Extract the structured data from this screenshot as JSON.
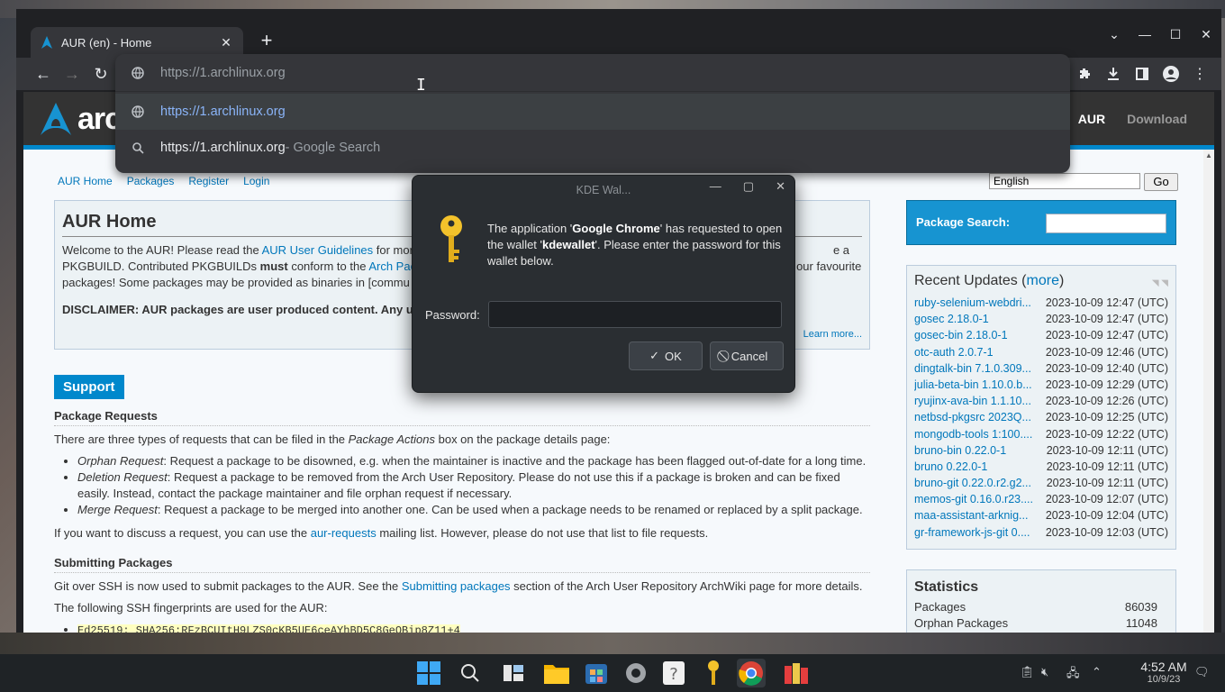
{
  "browser": {
    "tab_title": "AUR (en) - Home",
    "address_typed": "https://1.archlinux.org",
    "suggestions": [
      {
        "text": "https://1.archlinux.org",
        "suffix": ""
      },
      {
        "text": "https://1.archlinux.org",
        "suffix": " - Google Search"
      }
    ]
  },
  "site": {
    "logo_text": "arch",
    "nav": [
      "AUR",
      "Download"
    ],
    "subnav": [
      "AUR Home",
      "Packages",
      "Register",
      "Login"
    ],
    "language": "English",
    "go_label": "Go",
    "home_title": "AUR Home",
    "welcome_1a": "Welcome to the AUR! Please read the ",
    "welcome_link1": "AUR User Guidelines",
    "welcome_1b": " for mor",
    "welcome_1c": "e a",
    "welcome_2a": "PKGBUILD. Contributed PKGBUILDs ",
    "welcome_must": "must",
    "welcome_2b": " conform to the ",
    "welcome_link2": "Arch Pac",
    "welcome_2c": "our favourite",
    "welcome_3": "packages! Some packages may be provided as binaries in [commu",
    "disclaimer": "DISCLAIMER: AUR packages are user produced content. Any u",
    "learn_more": "Learn more...",
    "support_heading": "Support",
    "pkg_requests_title": "Package Requests",
    "pkg_requests_intro_a": "There are three types of requests that can be filed in the ",
    "pkg_requests_intro_em": "Package Actions",
    "pkg_requests_intro_b": " box on the package details page:",
    "requests": [
      {
        "name": "Orphan Request",
        "text": ": Request a package to be disowned, e.g. when the maintainer is inactive and the package has been flagged out-of-date for a long time."
      },
      {
        "name": "Deletion Request",
        "text": ": Request a package to be removed from the Arch User Repository. Please do not use this if a package is broken and can be fixed easily. Instead, contact the package maintainer and file orphan request if necessary."
      },
      {
        "name": "Merge Request",
        "text": ": Request a package to be merged into another one. Can be used when a package needs to be renamed or replaced by a split package."
      }
    ],
    "discuss_a": "If you want to discuss a request, you can use the ",
    "discuss_link": "aur-requests",
    "discuss_b": " mailing list. However, please do not use that list to file requests.",
    "submit_title": "Submitting Packages",
    "submit_a": "Git over SSH is now used to submit packages to the AUR. See the ",
    "submit_link": "Submitting packages",
    "submit_b": " section of the Arch User Repository ArchWiki page for more details.",
    "fingerprints_intro": "The following SSH fingerprints are used for the AUR:",
    "fingerprint": "Ed25519: SHA256:RFzBCUItH9LZS0cKB5UE6ceAYhBD5C8GeOBip8Z11+4",
    "search_label": "Package Search:",
    "updates_title": "Recent Updates",
    "updates_more": "more",
    "updates": [
      {
        "name": "ruby-selenium-webdri...",
        "date": "2023-10-09 12:47 (UTC)"
      },
      {
        "name": "gosec 2.18.0-1",
        "date": "2023-10-09 12:47 (UTC)"
      },
      {
        "name": "gosec-bin 2.18.0-1",
        "date": "2023-10-09 12:47 (UTC)"
      },
      {
        "name": "otc-auth 2.0.7-1",
        "date": "2023-10-09 12:46 (UTC)"
      },
      {
        "name": "dingtalk-bin 7.1.0.309...",
        "date": "2023-10-09 12:40 (UTC)"
      },
      {
        "name": "julia-beta-bin 1.10.0.b...",
        "date": "2023-10-09 12:29 (UTC)"
      },
      {
        "name": "ryujinx-ava-bin 1.1.10...",
        "date": "2023-10-09 12:26 (UTC)"
      },
      {
        "name": "netbsd-pkgsrc 2023Q...",
        "date": "2023-10-09 12:25 (UTC)"
      },
      {
        "name": "mongodb-tools 1:100....",
        "date": "2023-10-09 12:22 (UTC)"
      },
      {
        "name": "bruno-bin 0.22.0-1",
        "date": "2023-10-09 12:11 (UTC)"
      },
      {
        "name": "bruno 0.22.0-1",
        "date": "2023-10-09 12:11 (UTC)"
      },
      {
        "name": "bruno-git 0.22.0.r2.g2...",
        "date": "2023-10-09 12:11 (UTC)"
      },
      {
        "name": "memos-git 0.16.0.r23....",
        "date": "2023-10-09 12:07 (UTC)"
      },
      {
        "name": "maa-assistant-arknig...",
        "date": "2023-10-09 12:04 (UTC)"
      },
      {
        "name": "gr-framework-js-git 0....",
        "date": "2023-10-09 12:03 (UTC)"
      }
    ],
    "stats_title": "Statistics",
    "stats": [
      {
        "label": "Packages",
        "value": "86039"
      },
      {
        "label": "Orphan Packages",
        "value": "11048"
      }
    ]
  },
  "dialog": {
    "title": "KDE Wal...",
    "msg_a": "The application '",
    "msg_app": "Google Chrome",
    "msg_b": "' has requested to open the wallet '",
    "msg_wallet": "kdewallet",
    "msg_c": "'. Please enter the password for this wallet below.",
    "password_label": "Password:",
    "ok_label": "OK",
    "cancel_label": "Cancel"
  },
  "taskbar": {
    "time": "4:52 AM",
    "date": "10/9/23"
  },
  "colors": {
    "arch_blue": "#1793d1",
    "dialog_bg": "#2a2e32",
    "chrome_dark": "#35363a"
  }
}
